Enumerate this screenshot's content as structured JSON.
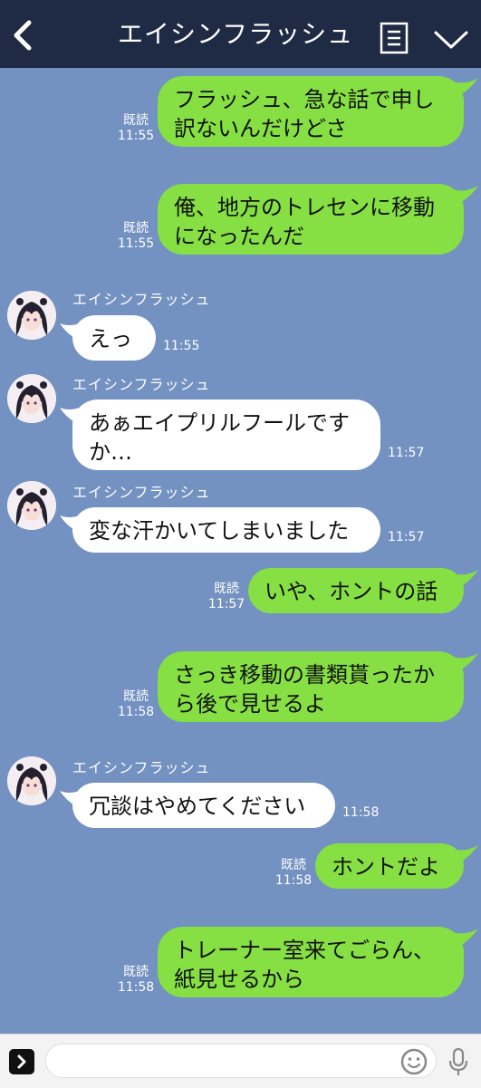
{
  "header": {
    "title": "エイシンフラッシュ"
  },
  "contact": {
    "name": "エイシンフラッシュ"
  },
  "messages": [
    {
      "side": "out",
      "text": "フラッシュ、急な話で申し\n訳ないんだけどさ",
      "read": "既読",
      "time": "11:55"
    },
    {
      "side": "out",
      "text": "俺、地方のトレセンに移動\nになったんだ",
      "read": "既読",
      "time": "11:55"
    },
    {
      "side": "in",
      "text": "えっ",
      "time": "11:55"
    },
    {
      "side": "in",
      "text": "あぁエイプリルフールです\nか…",
      "time": "11:57"
    },
    {
      "side": "in",
      "text": "変な汗かいてしまいました",
      "time": "11:57"
    },
    {
      "side": "out",
      "text": "いや、ホントの話",
      "read": "既読",
      "time": "11:57"
    },
    {
      "side": "out",
      "text": "さっき移動の書類貰ったか\nら後で見せるよ",
      "read": "既読",
      "time": "11:58"
    },
    {
      "side": "in",
      "text": "冗談はやめてください",
      "time": "11:58"
    },
    {
      "side": "out",
      "text": "ホントだよ",
      "read": "既読",
      "time": "11:58"
    },
    {
      "side": "out",
      "text": "トレーナー室来てごらん、\n紙見せるから",
      "read": "既読",
      "time": "11:58"
    }
  ],
  "composer": {
    "placeholder": ""
  },
  "colors": {
    "background": "#7391c1",
    "header": "#1f2a44",
    "outgoing_bubble": "#86df43",
    "incoming_bubble": "#ffffff"
  },
  "icons": {
    "back": "chevron-left-icon",
    "notes": "notes-icon",
    "menu": "chevron-down-icon",
    "expand": "expand-icon",
    "emoji": "emoji-icon",
    "mic": "microphone-icon"
  }
}
